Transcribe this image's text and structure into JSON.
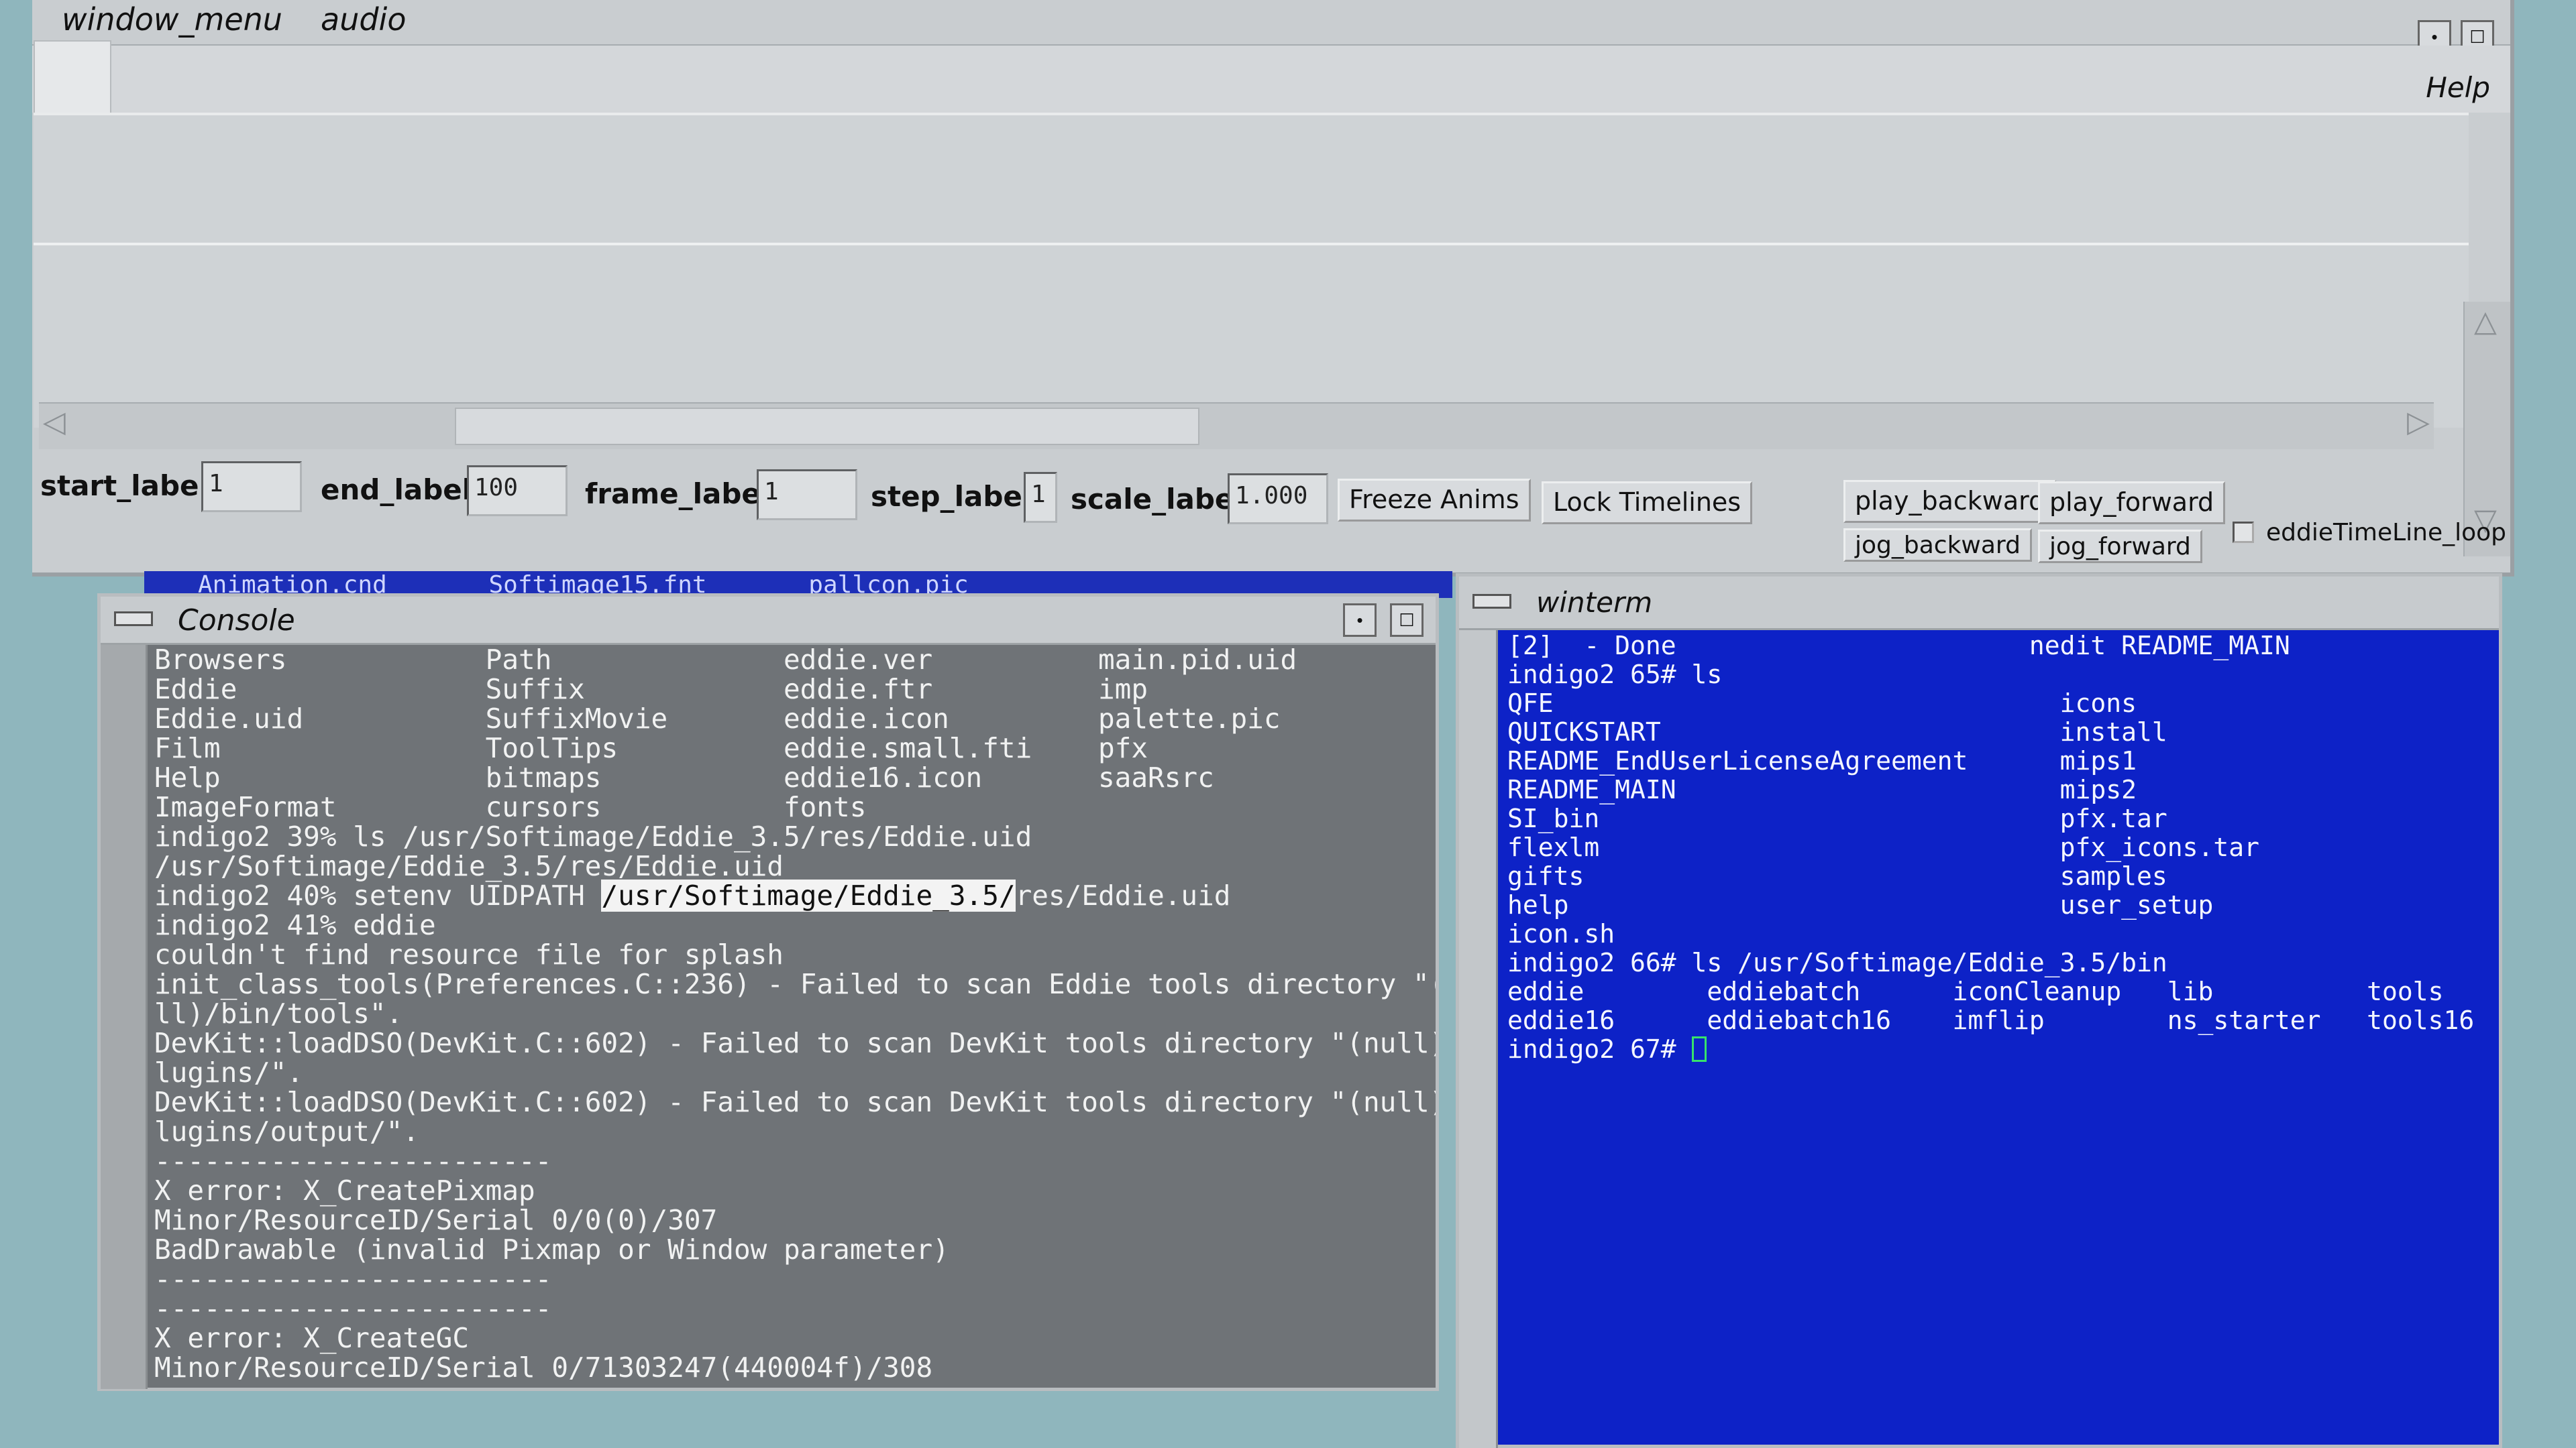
{
  "menubar": {
    "items": [
      "window_menu",
      "audio"
    ],
    "help": "Help"
  },
  "timeline": {
    "start_label": "start_label",
    "start_value": "1",
    "end_label": "end_label",
    "end_value": "100",
    "frame_label": "frame_label",
    "frame_value": "1",
    "step_label": "step_label",
    "step_value": "1",
    "scale_label": "scale_label",
    "scale_value": "1.000",
    "freeze_button": "Freeze Anims",
    "lock_button": "Lock Timelines",
    "play_backward": "play_backward",
    "play_forward": "play_forward",
    "jog_backward": "jog_backward",
    "jog_forward": "jog_forward",
    "loop_label": "eddieTimeLine_loop"
  },
  "behind_window_text": "Animation.cnd       Softimage15.fnt       pallcon.pic",
  "console": {
    "title": "Console",
    "lines": [
      "Browsers            Path              eddie.ver          main.pid.uid",
      "Eddie               Suffix            eddie.ftr          imp",
      "Eddie.uid           SuffixMovie       eddie.icon         palette.pic",
      "Film                ToolTips          eddie.small.fti    pfx",
      "Help                bitmaps           eddie16.icon       saaRsrc",
      "ImageFormat         cursors           fonts",
      "indigo2 39% ls /usr/Softimage/Eddie_3.5/res/Eddie.uid",
      "/usr/Softimage/Eddie_3.5/res/Eddie.uid",
      "indigo2 40% setenv UIDPATH ",
      "indigo2 41% eddie",
      "couldn't find resource file for splash",
      "init_class_tools(Preferences.C::236) - Failed to scan Eddie tools directory \"(nu",
      "ll)/bin/tools\".",
      "DevKit::loadDSO(DevKit.C::602) - Failed to scan DevKit tools directory \"(null)/p",
      "lugins/\".",
      "DevKit::loadDSO(DevKit.C::602) - Failed to scan DevKit tools directory \"(null)/p",
      "lugins/output/\".",
      "------------------------",
      "X error: X_CreatePixmap",
      "Minor/ResourceID/Serial 0/0(0)/307",
      "BadDrawable (invalid Pixmap or Window parameter)",
      "------------------------",
      "------------------------",
      "X error: X_CreateGC",
      "Minor/ResourceID/Serial 0/71303247(440004f)/308"
    ],
    "highlight": "/usr/Softimage/Eddie_3.5/",
    "highlight_suffix": "res/Eddie.uid"
  },
  "winterm": {
    "title": "winterm",
    "lines": [
      "[2]  - Done                       nedit README_MAIN",
      "indigo2 65# ls",
      "QFE                                 icons",
      "QUICKSTART                          install",
      "README_EndUserLicenseAgreement      mips1",
      "README_MAIN                         mips2",
      "SI_bin                              pfx.tar",
      "flexlm                              pfx_icons.tar",
      "gifts                               samples",
      "help                                user_setup",
      "icon.sh",
      "indigo2 66# ls /usr/Softimage/Eddie_3.5/bin",
      "eddie        eddiebatch      iconCleanup   lib          tools",
      "eddie16      eddiebatch16    imflip        ns_starter   tools16"
    ],
    "prompt": "indigo2 67# "
  },
  "colors": {
    "terminal_bg": "#0d22c7",
    "console_bg": "#6f7377",
    "cursor": "#37e26b"
  }
}
